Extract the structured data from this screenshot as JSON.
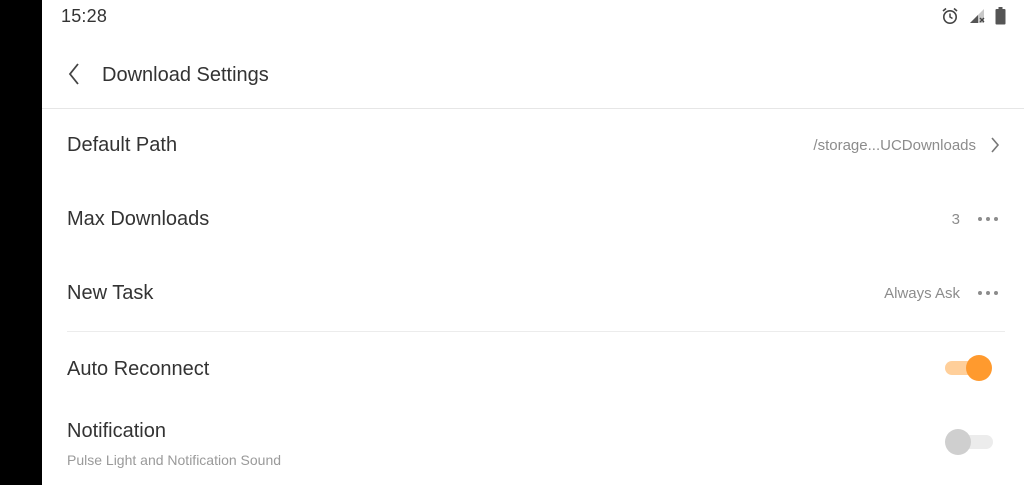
{
  "status_bar": {
    "time": "15:28",
    "icons": [
      "alarm-icon",
      "signal-icon",
      "battery-icon"
    ]
  },
  "header": {
    "back_icon": "chevron-left-icon",
    "title": "Download Settings"
  },
  "settings": {
    "default_path": {
      "label": "Default Path",
      "value": "/storage...UCDownloads",
      "icon": "chevron-right-icon"
    },
    "max_downloads": {
      "label": "Max Downloads",
      "value": "3",
      "icon": "more-dots-icon"
    },
    "new_task": {
      "label": "New Task",
      "value": "Always Ask",
      "icon": "more-dots-icon"
    },
    "auto_reconnect": {
      "label": "Auto Reconnect",
      "enabled": true
    },
    "notification": {
      "label": "Notification",
      "subtitle": "Pulse Light and Notification Sound",
      "enabled": false
    }
  },
  "colors": {
    "accent": "#ff9a2e",
    "accent_track": "#ffcf9a",
    "text_primary": "#333333",
    "text_secondary": "#8c8c8c"
  }
}
